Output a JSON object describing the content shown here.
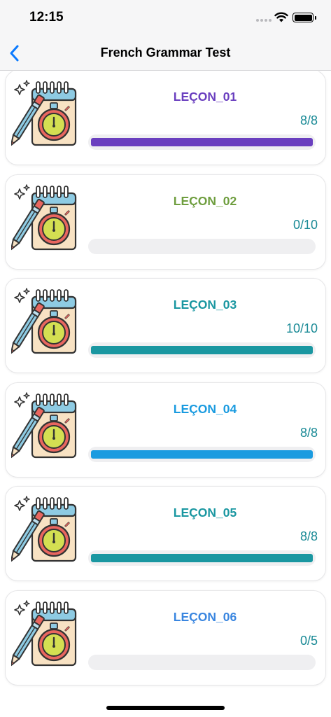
{
  "status_bar": {
    "time": "12:15"
  },
  "nav": {
    "title": "French Grammar Test",
    "back_icon": "chevron-left-icon"
  },
  "lessons": [
    {
      "title": "LEÇON_01",
      "score": "8/8",
      "progress": 1.0,
      "color": "#6a3fbf",
      "icon": "notebook-stopwatch-icon"
    },
    {
      "title": "LEÇON_02",
      "score": "0/10",
      "progress": 0.0,
      "color": "#6f9e3f",
      "icon": "notebook-stopwatch-icon"
    },
    {
      "title": "LEÇON_03",
      "score": "10/10",
      "progress": 1.0,
      "color": "#1a97a1",
      "icon": "notebook-stopwatch-icon"
    },
    {
      "title": "LEÇON_04",
      "score": "8/8",
      "progress": 1.0,
      "color": "#1a9be0",
      "icon": "notebook-stopwatch-icon"
    },
    {
      "title": "LEÇON_05",
      "score": "8/8",
      "progress": 1.0,
      "color": "#1a97a1",
      "icon": "notebook-stopwatch-icon"
    },
    {
      "title": "LEÇON_06",
      "score": "0/5",
      "progress": 0.0,
      "color": "#3a86e0",
      "icon": "notebook-stopwatch-icon"
    }
  ],
  "colors": {
    "score_text": "#1a8a96",
    "accent": "#0a7aff"
  }
}
